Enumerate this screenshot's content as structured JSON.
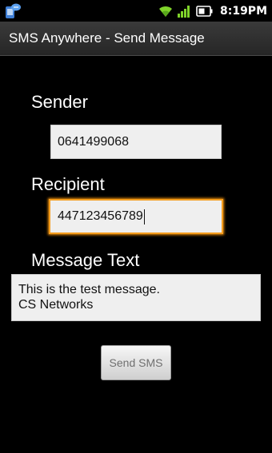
{
  "status_bar": {
    "time": "8:19PM",
    "icons": [
      "sms-notification-icon",
      "wifi-icon",
      "signal-icon",
      "battery-icon"
    ]
  },
  "app": {
    "title": "SMS Anywhere - Send Message"
  },
  "form": {
    "sender_label": "Sender",
    "sender_value": "0641499068",
    "recipient_label": "Recipient",
    "recipient_value": "447123456789",
    "message_label": "Message Text",
    "message_value": "This is the test message.\nCS Networks",
    "send_button_label": "Send SMS"
  },
  "colors": {
    "background": "#000000",
    "focus_border": "#f59d1e",
    "status_icons": "#7fd32a"
  }
}
